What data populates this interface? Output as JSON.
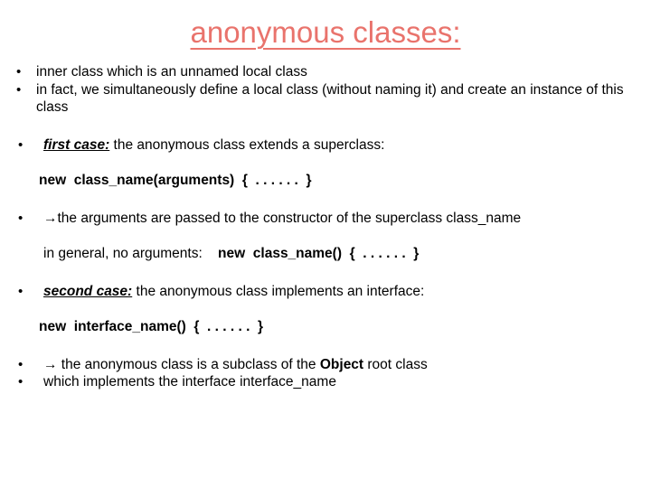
{
  "slide": {
    "title": "anonymous classes:",
    "title_color": "#e9736c",
    "background_color": "#ffffff",
    "bullet_glyph": "•",
    "arrow_glyph": "→",
    "blocks": {
      "b1_line1": "inner class which is an unnamed local class",
      "b1_line2": "in fact, we simultaneously define a local class (without naming it) and create an instance of this class",
      "b2_label": "first case:",
      "b2_rest": " the anonymous class extends a superclass:",
      "code1": "new  class_name(arguments)  {  . . . . . .  }",
      "b3_text": "the arguments are passed to the constructor of the superclass class_name",
      "general_label": "in general, no arguments:",
      "code2": "new  class_name()  {  . . . . . .  }",
      "b4_label": "second case:",
      "b4_rest": " the anonymous class implements an interface:",
      "code3": "new  interface_name()  {  . . . . . .  }",
      "b5_pre": " the anonymous class is a subclass of the ",
      "b5_bold": "Object",
      "b5_post": " root class",
      "b6_text": "which implements the interface interface_name"
    }
  }
}
